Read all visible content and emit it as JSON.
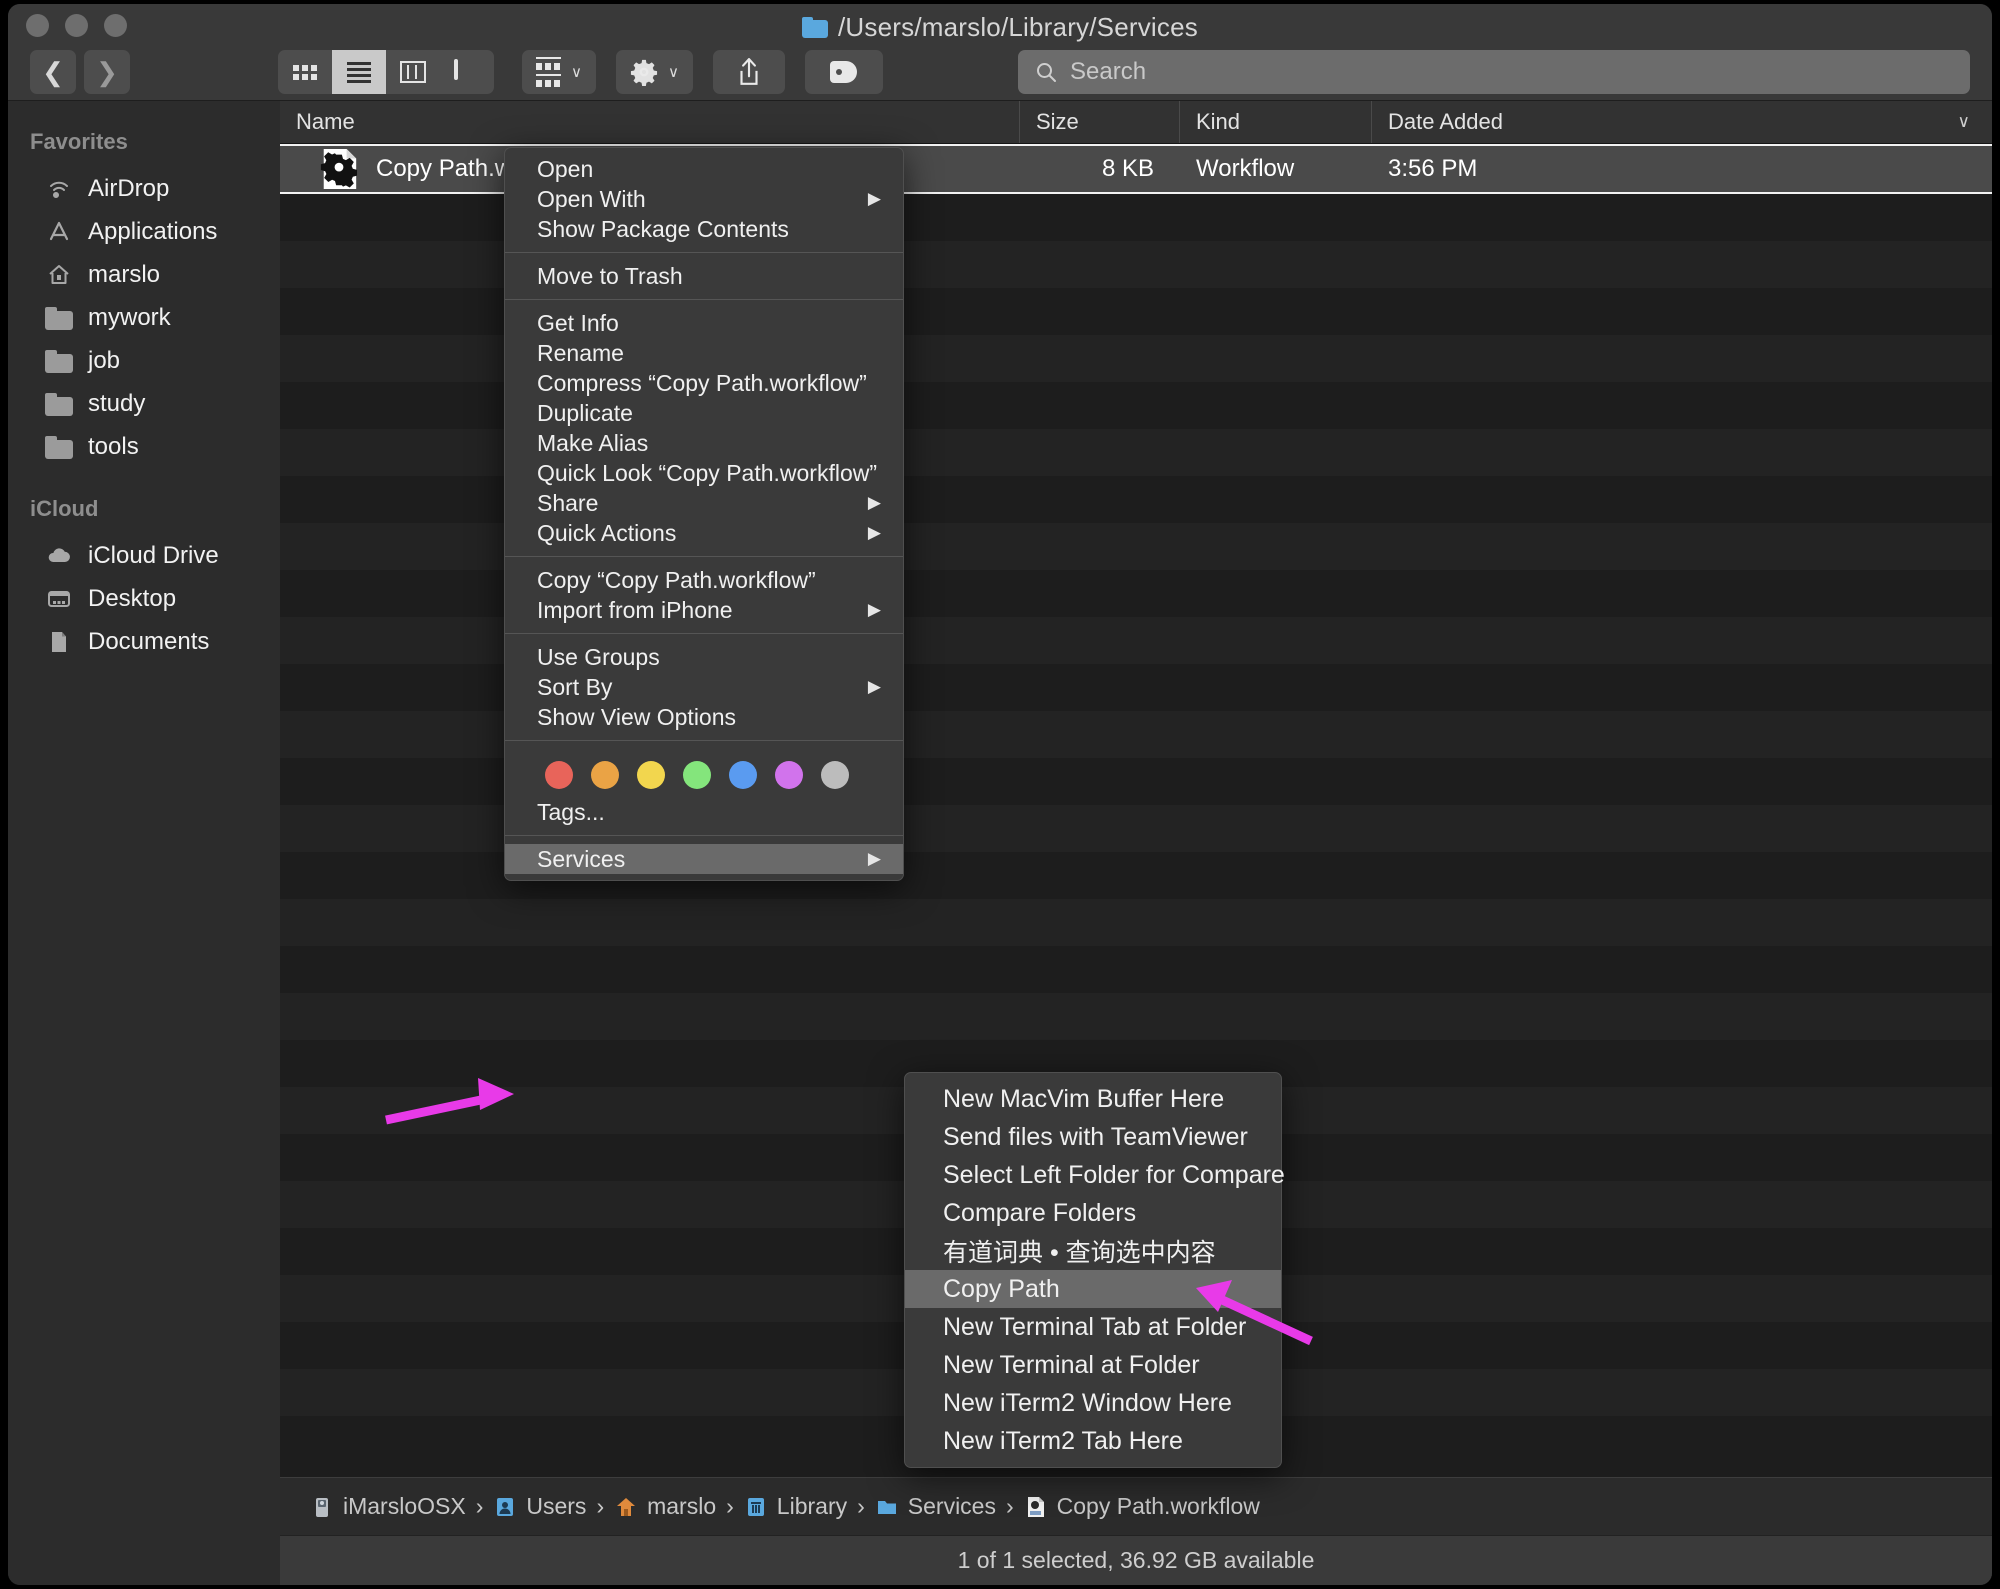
{
  "window": {
    "title": "/Users/marslo/Library/Services",
    "title_icon": "folder-icon"
  },
  "toolbar": {
    "back_label": "❮",
    "forward_label": "❯",
    "view_icon_label": "icon-view-icon",
    "view_list_label": "list-view-icon",
    "view_column_label": "column-view-icon",
    "view_gallery_label": "gallery-view-icon",
    "group_label": "group-by-icon",
    "action_label": "gear-icon",
    "share_label": "share-icon",
    "tags_label": "tag-icon",
    "chevron": "∨"
  },
  "search": {
    "placeholder": "Search",
    "icon": "search-icon",
    "value": ""
  },
  "sidebar": {
    "sections": [
      {
        "title": "Favorites",
        "items": [
          {
            "label": "AirDrop",
            "icon": "airdrop-icon"
          },
          {
            "label": "Applications",
            "icon": "applications-icon"
          },
          {
            "label": "marslo",
            "icon": "home-icon"
          },
          {
            "label": "mywork",
            "icon": "folder-icon"
          },
          {
            "label": "job",
            "icon": "folder-icon"
          },
          {
            "label": "study",
            "icon": "folder-icon"
          },
          {
            "label": "tools",
            "icon": "folder-icon"
          }
        ]
      },
      {
        "title": "iCloud",
        "items": [
          {
            "label": "iCloud Drive",
            "icon": "cloud-icon"
          },
          {
            "label": "Desktop",
            "icon": "desktop-icon"
          },
          {
            "label": "Documents",
            "icon": "document-icon"
          }
        ]
      }
    ]
  },
  "filelist": {
    "columns": [
      "Name",
      "Size",
      "Kind",
      "Date Added"
    ],
    "sort_chevron": "∨",
    "rows": [
      {
        "name": "Copy Path.workflow",
        "size": "8 KB",
        "kind": "Workflow",
        "date_added": "3:56 PM",
        "icon": "workflow-gear-icon",
        "selected": true
      }
    ]
  },
  "context_menu": {
    "groups": [
      {
        "items": [
          {
            "label": "Open",
            "submenu": false
          },
          {
            "label": "Open With",
            "submenu": true
          },
          {
            "label": "Show Package Contents",
            "submenu": false
          }
        ]
      },
      {
        "items": [
          {
            "label": "Move to Trash",
            "submenu": false
          }
        ]
      },
      {
        "items": [
          {
            "label": "Get Info",
            "submenu": false
          },
          {
            "label": "Rename",
            "submenu": false
          },
          {
            "label": "Compress “Copy Path.workflow”",
            "submenu": false
          },
          {
            "label": "Duplicate",
            "submenu": false
          },
          {
            "label": "Make Alias",
            "submenu": false
          },
          {
            "label": "Quick Look “Copy Path.workflow”",
            "submenu": false
          },
          {
            "label": "Share",
            "submenu": true
          },
          {
            "label": "Quick Actions",
            "submenu": true
          }
        ]
      },
      {
        "items": [
          {
            "label": "Copy “Copy Path.workflow”",
            "submenu": false
          },
          {
            "label": "Import from iPhone",
            "submenu": true
          }
        ]
      },
      {
        "items": [
          {
            "label": "Use Groups",
            "submenu": false
          },
          {
            "label": "Sort By",
            "submenu": true
          },
          {
            "label": "Show View Options",
            "submenu": false
          }
        ]
      }
    ],
    "tags": {
      "label": "Tags...",
      "colors": [
        "#ea6153",
        "#eda444",
        "#f0d košt"
      ]
    },
    "services_item": {
      "label": "Services",
      "submenu": true,
      "highlighted": true
    },
    "arrow_glyph": "▶"
  },
  "tag_colors": [
    "#e8645a",
    "#eaa345",
    "#f2d64e",
    "#84e57c",
    "#5a9bf0",
    "#d173ec",
    "#bcbcbc"
  ],
  "tags_label": "Tags...",
  "services_submenu": {
    "items": [
      {
        "label": "New MacVim Buffer Here",
        "highlighted": false
      },
      {
        "label": "Send files with TeamViewer",
        "highlighted": false
      },
      {
        "label": "Select Left Folder for Compare",
        "highlighted": false
      },
      {
        "label": "Compare Folders",
        "highlighted": false
      },
      {
        "label": "有道词典 • 查询选中内容",
        "highlighted": false
      },
      {
        "label": "Copy Path",
        "highlighted": true
      },
      {
        "label": "New Terminal Tab at Folder",
        "highlighted": false
      },
      {
        "label": "New Terminal at Folder",
        "highlighted": false
      },
      {
        "label": "New iTerm2 Window Here",
        "highlighted": false
      },
      {
        "label": "New iTerm2 Tab Here",
        "highlighted": false
      }
    ]
  },
  "breadcrumb": {
    "separator": "›",
    "items": [
      {
        "label": "iMarsloOSX",
        "icon": "drive-icon"
      },
      {
        "label": "Users",
        "icon": "users-icon"
      },
      {
        "label": "marslo",
        "icon": "home-icon"
      },
      {
        "label": "Library",
        "icon": "library-icon"
      },
      {
        "label": "Services",
        "icon": "folder-icon"
      },
      {
        "label": "Copy Path.workflow",
        "icon": "workflow-icon"
      }
    ]
  },
  "status": {
    "text": "1 of 1 selected, 36.92 GB available"
  },
  "annotations": {
    "arrow_color": "#e83ae8",
    "arrows": [
      "services-pointer-arrow",
      "copy-path-pointer-arrow"
    ]
  }
}
